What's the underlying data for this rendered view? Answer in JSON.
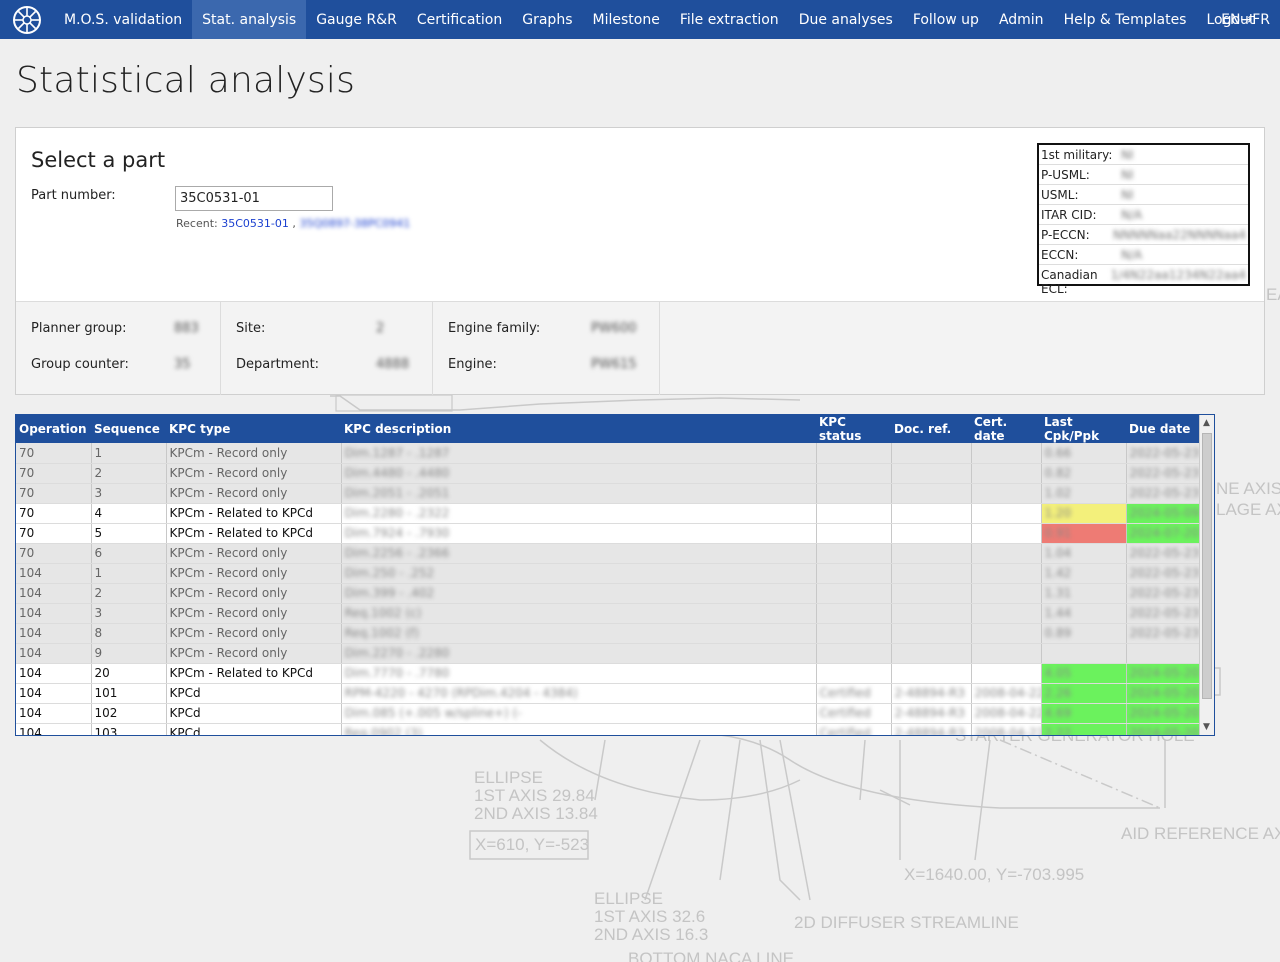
{
  "nav": {
    "items": [
      {
        "label": "M.O.S. validation",
        "active": false
      },
      {
        "label": "Stat. analysis",
        "active": true
      },
      {
        "label": "Gauge R&R",
        "active": false
      },
      {
        "label": "Certification",
        "active": false
      },
      {
        "label": "Graphs",
        "active": false
      },
      {
        "label": "Milestone",
        "active": false
      },
      {
        "label": "File extraction",
        "active": false
      },
      {
        "label": "Due analyses",
        "active": false
      },
      {
        "label": "Follow up",
        "active": false
      },
      {
        "label": "Admin",
        "active": false
      },
      {
        "label": "Help & Templates",
        "active": false
      },
      {
        "label": "Logout",
        "active": false
      }
    ],
    "language": "EN→FR"
  },
  "page_title": "Statistical analysis",
  "select_part": {
    "title": "Select a part",
    "part_number_label": "Part number:",
    "part_number_value": "35C0531-01",
    "recent_label": "Recent:",
    "recent_link_1": "35C0531-01",
    "recent_separator": ",",
    "recent_link_2": "35Q0897-38PC0941"
  },
  "export_control": [
    {
      "label": "1st military:",
      "value": "NI"
    },
    {
      "label": "P-USML:",
      "value": "NI"
    },
    {
      "label": "USML:",
      "value": "NI"
    },
    {
      "label": "ITAR CID:",
      "value": "N/A"
    },
    {
      "label": "P-ECCN:",
      "value": "NNNNNaa22NNNNaa4"
    },
    {
      "label": "ECCN:",
      "value": "N/A"
    },
    {
      "label": "Canadian ECL:",
      "value": "1/4N22aa1234N22aa4"
    }
  ],
  "part_info": {
    "planner_group_label": "Planner group:",
    "planner_group_value": "883",
    "group_counter_label": "Group counter:",
    "group_counter_value": "35",
    "site_label": "Site:",
    "site_value": "2",
    "department_label": "Department:",
    "department_value": "4888",
    "engine_family_label": "Engine family:",
    "engine_family_value": "PW600",
    "engine_label": "Engine:",
    "engine_value": "PW615"
  },
  "table": {
    "headers": [
      "Operation",
      "Sequence",
      "KPC type",
      "KPC description",
      "KPC status",
      "Doc. ref.",
      "Cert. date",
      "Last Cpk/Ppk",
      "Due date"
    ],
    "rows": [
      {
        "op": "70",
        "seq": "1",
        "type": "KPCm - Record only",
        "desc": "Dim.1287 - .1287",
        "status": "",
        "doc": "",
        "cert": "",
        "cpk": "0.66",
        "due": "2022-05-23",
        "style": "ro",
        "cpk_color": "",
        "due_color": ""
      },
      {
        "op": "70",
        "seq": "2",
        "type": "KPCm - Record only",
        "desc": "Dim.4480 - .4480",
        "status": "",
        "doc": "",
        "cert": "",
        "cpk": "0.82",
        "due": "2022-05-23",
        "style": "ro",
        "cpk_color": "",
        "due_color": ""
      },
      {
        "op": "70",
        "seq": "3",
        "type": "KPCm - Record only",
        "desc": "Dim.2051 - .2051",
        "status": "",
        "doc": "",
        "cert": "",
        "cpk": "1.02",
        "due": "2022-05-23",
        "style": "ro",
        "cpk_color": "",
        "due_color": ""
      },
      {
        "op": "70",
        "seq": "4",
        "type": "KPCm - Related to KPCd",
        "desc": "Dim.2280 - .2322",
        "status": "",
        "doc": "",
        "cert": "",
        "cpk": "1.20",
        "due": "2024-05-09",
        "style": "act",
        "cpk_color": "yellow",
        "due_color": "green"
      },
      {
        "op": "70",
        "seq": "5",
        "type": "KPCm - Related to KPCd",
        "desc": "Dim.7924 - .7930",
        "status": "",
        "doc": "",
        "cert": "",
        "cpk": "0.91",
        "due": "2024-07-20",
        "style": "act",
        "cpk_color": "red",
        "due_color": "green"
      },
      {
        "op": "70",
        "seq": "6",
        "type": "KPCm - Record only",
        "desc": "Dim.2256 - .2366",
        "status": "",
        "doc": "",
        "cert": "",
        "cpk": "1.04",
        "due": "2022-05-23",
        "style": "ro",
        "cpk_color": "",
        "due_color": ""
      },
      {
        "op": "104",
        "seq": "1",
        "type": "KPCm - Record only",
        "desc": "Dim.250 - .252",
        "status": "",
        "doc": "",
        "cert": "",
        "cpk": "1.42",
        "due": "2022-05-23",
        "style": "ro",
        "cpk_color": "",
        "due_color": ""
      },
      {
        "op": "104",
        "seq": "2",
        "type": "KPCm - Record only",
        "desc": "Dim.399 - .402",
        "status": "",
        "doc": "",
        "cert": "",
        "cpk": "1.31",
        "due": "2022-05-23",
        "style": "ro",
        "cpk_color": "",
        "due_color": ""
      },
      {
        "op": "104",
        "seq": "3",
        "type": "KPCm - Record only",
        "desc": "Req.1002 (c)",
        "status": "",
        "doc": "",
        "cert": "",
        "cpk": "1.44",
        "due": "2022-05-23",
        "style": "ro",
        "cpk_color": "",
        "due_color": ""
      },
      {
        "op": "104",
        "seq": "8",
        "type": "KPCm - Record only",
        "desc": "Req.1002 (f)",
        "status": "",
        "doc": "",
        "cert": "",
        "cpk": "0.89",
        "due": "2022-05-23",
        "style": "ro",
        "cpk_color": "",
        "due_color": ""
      },
      {
        "op": "104",
        "seq": "9",
        "type": "KPCm - Record only",
        "desc": "Dim.2270 - .2280",
        "status": "",
        "doc": "",
        "cert": "",
        "cpk": "",
        "due": "",
        "style": "ro",
        "cpk_color": "",
        "due_color": ""
      },
      {
        "op": "104",
        "seq": "20",
        "type": "KPCm - Related to KPCd",
        "desc": "Dim.7770 - .7780",
        "status": "",
        "doc": "",
        "cert": "",
        "cpk": "4.05",
        "due": "2024-05-20",
        "style": "act",
        "cpk_color": "green",
        "due_color": "green"
      },
      {
        "op": "104",
        "seq": "101",
        "type": "KPCd",
        "desc": "RPM-4220 - 4270 (RPDim.4204 - 4384)",
        "status": "Certified",
        "doc": "2-48894-R3",
        "cert": "2008-04-22",
        "cpk": "2.26",
        "due": "2024-05-20",
        "style": "act",
        "cpk_color": "green",
        "due_color": "green"
      },
      {
        "op": "104",
        "seq": "102",
        "type": "KPCd",
        "desc": "Dim.085 (+.005 w/spline+) (-",
        "status": "Certified",
        "doc": "2-48894-R3",
        "cert": "2008-04-22",
        "cpk": "4.69",
        "due": "2024-05-20",
        "style": "act",
        "cpk_color": "green",
        "due_color": "green"
      },
      {
        "op": "104",
        "seq": "103",
        "type": "KPCd",
        "desc": "Req.0902 (3)",
        "status": "Certified",
        "doc": "2-48894-R3",
        "cert": "2008-04-22",
        "cpk": "2.22",
        "due": "2024-05-20",
        "style": "act",
        "cpk_color": "green",
        "due_color": "green"
      }
    ]
  },
  "drawing_labels": {
    "ellipse1": "ELLIPSE\n1ST AXIS 29.84\n2ND AXIS 13.84",
    "coord1": "X=610, Y=-523",
    "ellipse2": "ELLIPSE\n1ST AXIS 32.6\n2ND AXIS 16.3",
    "diffuser": "2D DIFFUSER STREAMLINE",
    "naca": "BOTTOM NACA LINE",
    "coord2": "X=1640.00, Y=-703.995",
    "aid": "AID REFERENCE AXIS",
    "starter": "STARTER GENERATOR HOLE",
    "engine_axis": "NE AXIS",
    "fuselage_axis": "LAGE AXIS",
    "ea": "EA"
  }
}
